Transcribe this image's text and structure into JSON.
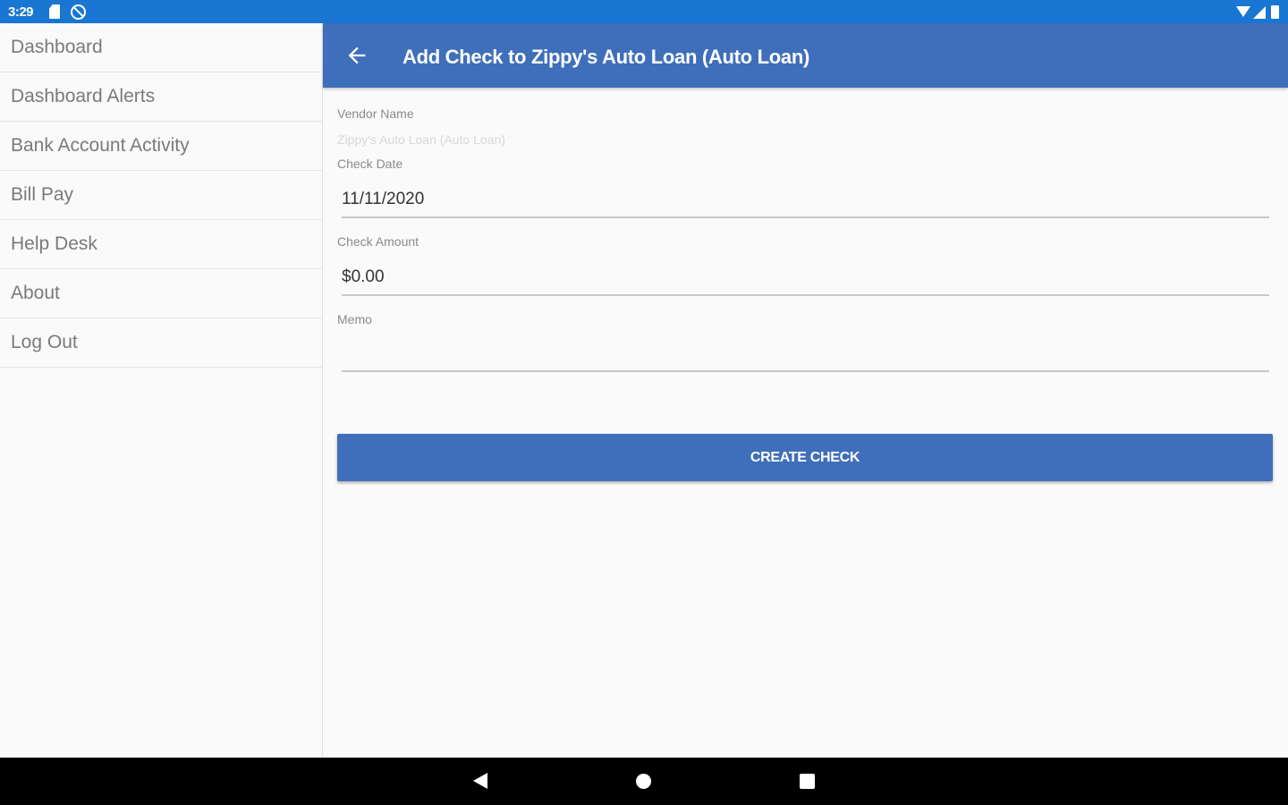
{
  "status_bar": {
    "time": "3:29",
    "icons": [
      "sd-card-icon",
      "do-not-disturb-icon",
      "wifi-icon",
      "signal-icon",
      "battery-icon"
    ]
  },
  "drawer": {
    "items": [
      {
        "label": "Dashboard"
      },
      {
        "label": "Dashboard Alerts"
      },
      {
        "label": "Bank Account Activity"
      },
      {
        "label": "Bill Pay"
      },
      {
        "label": "Help Desk"
      },
      {
        "label": "About"
      },
      {
        "label": "Log Out"
      }
    ]
  },
  "appbar": {
    "title": "Add Check to Zippy's Auto Loan (Auto Loan)",
    "back_icon": "arrow-back-icon",
    "color": "#3f6fbb"
  },
  "form": {
    "vendor_label": "Vendor Name",
    "vendor_value": "Zippy's Auto Loan (Auto Loan)",
    "date_label": "Check Date",
    "date_value": "11/11/2020",
    "amount_label": "Check Amount",
    "amount_value": "$0.00",
    "memo_label": "Memo",
    "memo_value": "",
    "create_label": "CREATE CHECK"
  },
  "nav_bar": {
    "icons": [
      "nav-back-icon",
      "nav-home-icon",
      "nav-recents-icon"
    ]
  },
  "colors": {
    "status_bar": "#1976d2",
    "accent": "#3f6fbb",
    "nav_bar": "#000000"
  }
}
